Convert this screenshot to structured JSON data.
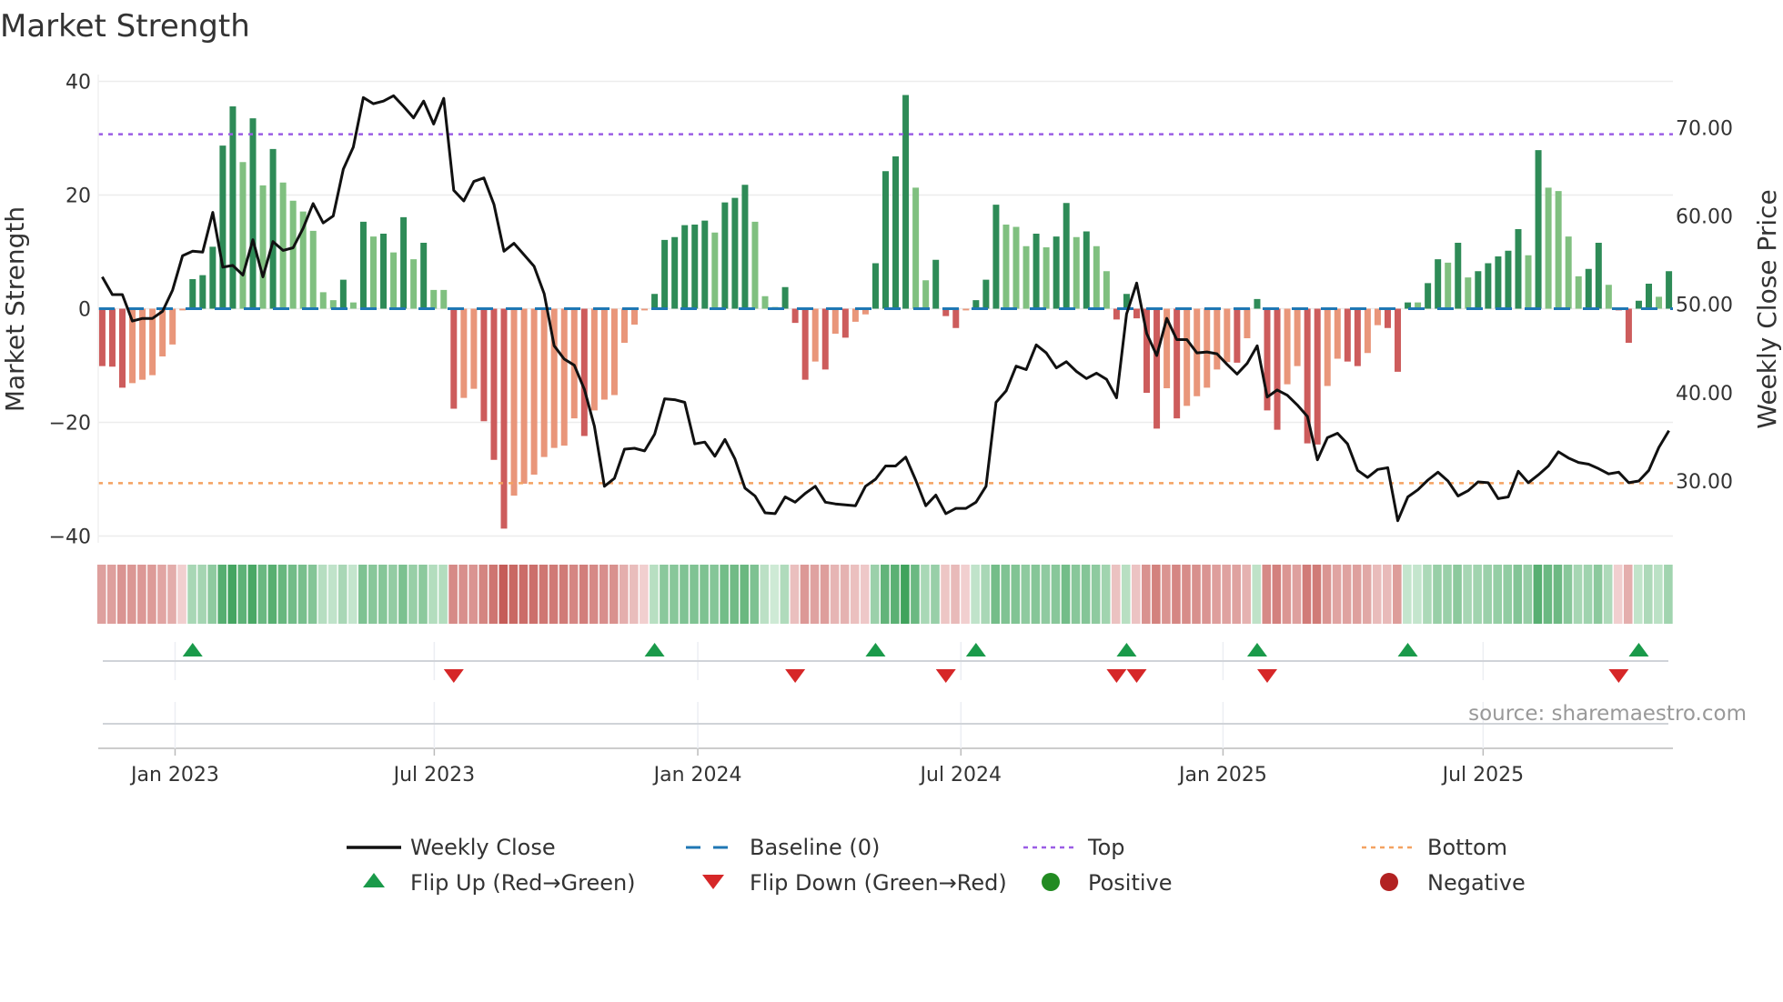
{
  "title": "Market Strength",
  "source": "source: sharemaestro.com",
  "colors": {
    "pos_strong": "#2e8b57",
    "pos_weak": "#80c080",
    "neg_strong": "#cd5c5c",
    "neg_weak": "#e9967a",
    "line": "#111111",
    "baseline": "#1f77b4",
    "top": "#9b5de5",
    "bottom": "#f4a261",
    "flip_up": "#1a9a4a",
    "flip_down": "#d62728",
    "positive": "#228b22",
    "negative": "#b22222"
  },
  "legend": [
    {
      "label": "Weekly Close",
      "kind": "line"
    },
    {
      "label": "Baseline (0)",
      "kind": "dash"
    },
    {
      "label": "Top",
      "kind": "dot-top"
    },
    {
      "label": "Bottom",
      "kind": "dot-bottom"
    },
    {
      "label": "Flip Up (Red→Green)",
      "kind": "tri-up"
    },
    {
      "label": "Flip Down (Green→Red)",
      "kind": "tri-down"
    },
    {
      "label": "Positive",
      "kind": "circle-pos"
    },
    {
      "label": "Negative",
      "kind": "circle-neg"
    }
  ],
  "chart_data": {
    "type": "bar+line",
    "title": "Market Strength",
    "ylabel": "Market Strength",
    "ylabel_right": "Weekly Close Price",
    "ylim": [
      -41.2,
      41.2
    ],
    "ylim_right": [
      23.0,
      76.0
    ],
    "yticks": [
      {
        "v": 40,
        "label": "40"
      },
      {
        "v": 20,
        "label": "20"
      },
      {
        "v": 0,
        "label": "0"
      },
      {
        "v": -20,
        "label": "−20"
      },
      {
        "v": -40,
        "label": "−40"
      }
    ],
    "yticks_right": [
      {
        "v": 70,
        "label": "70.00"
      },
      {
        "v": 60,
        "label": "60.00"
      },
      {
        "v": 50,
        "label": "50.00"
      },
      {
        "v": 40,
        "label": "40.00"
      },
      {
        "v": 30,
        "label": "30.00"
      }
    ],
    "top_level": 30.7,
    "bottom_level": -30.7,
    "baseline": 0,
    "x_unit": "week index",
    "xlim": [
      -0.4,
      156.4
    ],
    "xticks": [
      {
        "week": 7.25,
        "label": "Jan 2023"
      },
      {
        "week": 33.06,
        "label": "Jul 2023"
      },
      {
        "week": 59.3,
        "label": "Jan 2024"
      },
      {
        "week": 85.5,
        "label": "Jul 2024"
      },
      {
        "week": 111.6,
        "label": "Jan 2025"
      },
      {
        "week": 137.5,
        "label": "Jul 2025"
      }
    ],
    "strength": [
      -10.1,
      -10.2,
      -13.9,
      -13.1,
      -12.5,
      -11.7,
      -8.4,
      -6.3,
      -0.3,
      5.2,
      5.9,
      10.9,
      28.7,
      35.6,
      25.8,
      33.5,
      21.7,
      28.1,
      22.2,
      19.0,
      17.1,
      13.7,
      2.9,
      1.5,
      5.1,
      1.1,
      15.3,
      12.7,
      13.2,
      9.9,
      16.1,
      8.7,
      11.6,
      3.3,
      3.3,
      -17.6,
      -15.7,
      -14.1,
      -19.8,
      -26.6,
      -38.7,
      -32.9,
      -30.8,
      -29.2,
      -26.1,
      -24.5,
      -24.1,
      -19.3,
      -22.4,
      -17.9,
      -16.0,
      -15.2,
      -6.0,
      -2.8,
      -0.3,
      2.6,
      12.1,
      12.6,
      14.7,
      14.8,
      15.5,
      13.4,
      18.7,
      19.5,
      21.8,
      15.3,
      2.2,
      0.3,
      3.8,
      -2.5,
      -12.5,
      -9.3,
      -10.7,
      -4.4,
      -5.1,
      -2.3,
      -1.0,
      8.0,
      24.2,
      26.8,
      37.6,
      21.3,
      5.0,
      8.6,
      -1.3,
      -3.4,
      -0.3,
      1.5,
      5.1,
      18.3,
      14.8,
      14.4,
      11.0,
      13.2,
      10.8,
      12.7,
      18.6,
      12.6,
      13.6,
      11.0,
      6.6,
      -1.9,
      2.6,
      -1.7,
      -14.8,
      -21.1,
      -14.0,
      -19.3,
      -17.1,
      -15.4,
      -13.9,
      -10.7,
      -9.4,
      -9.5,
      -5.2,
      1.7,
      -17.9,
      -21.3,
      -13.3,
      -10.1,
      -23.7,
      -23.9,
      -13.6,
      -8.8,
      -9.3,
      -10.1,
      -7.8,
      -2.9,
      -3.4,
      -11.1,
      1.1,
      1.1,
      4.5,
      8.7,
      8.1,
      11.6,
      5.5,
      6.6,
      8.0,
      9.2,
      10.2,
      14.0,
      9.4,
      27.9,
      21.3,
      20.7,
      12.7,
      5.7,
      7.0,
      11.6,
      4.2,
      -0.3,
      -6.0,
      1.4,
      4.4,
      2.1,
      6.6
    ],
    "weekly_close": [
      53.1,
      51.1,
      51.1,
      48.1,
      48.4,
      48.4,
      49.2,
      51.6,
      55.5,
      56.0,
      55.9,
      60.4,
      54.2,
      54.4,
      53.3,
      57.3,
      53.1,
      57.1,
      56.1,
      56.4,
      58.6,
      61.4,
      59.2,
      60.0,
      65.3,
      67.8,
      73.4,
      72.7,
      73.0,
      73.6,
      72.4,
      71.1,
      73.0,
      70.4,
      73.3,
      62.9,
      61.7,
      63.9,
      64.3,
      61.3,
      56.0,
      56.9,
      55.6,
      54.3,
      51.2,
      45.3,
      43.8,
      43.1,
      40.4,
      36.2,
      29.4,
      30.3,
      33.6,
      33.7,
      33.4,
      35.3,
      39.3,
      39.2,
      38.9,
      34.2,
      34.4,
      32.8,
      34.7,
      32.5,
      29.2,
      28.3,
      26.4,
      26.3,
      28.2,
      27.6,
      28.6,
      29.4,
      27.6,
      27.4,
      27.3,
      27.2,
      29.4,
      30.2,
      31.7,
      31.7,
      32.7,
      30.1,
      27.2,
      28.4,
      26.3,
      26.9,
      26.9,
      27.6,
      29.4,
      38.9,
      40.2,
      43.0,
      42.6,
      45.4,
      44.5,
      42.8,
      43.5,
      42.4,
      41.6,
      42.2,
      41.5,
      39.4,
      48.9,
      52.4,
      46.7,
      44.2,
      48.4,
      46.0,
      46.0,
      44.5,
      44.6,
      44.4,
      43.2,
      42.1,
      43.3,
      45.3,
      39.5,
      40.3,
      39.7,
      38.6,
      37.3,
      32.4,
      34.9,
      35.4,
      34.2,
      31.2,
      30.4,
      31.3,
      31.5,
      25.5,
      28.2,
      29.0,
      30.1,
      31.0,
      30.0,
      28.3,
      28.9,
      29.9,
      29.8,
      28.0,
      28.2,
      31.1,
      29.8,
      30.7,
      31.7,
      33.3,
      32.6,
      32.1,
      31.9,
      31.4,
      30.8,
      31.0,
      29.8,
      30.0,
      31.2,
      33.8,
      35.7
    ]
  }
}
